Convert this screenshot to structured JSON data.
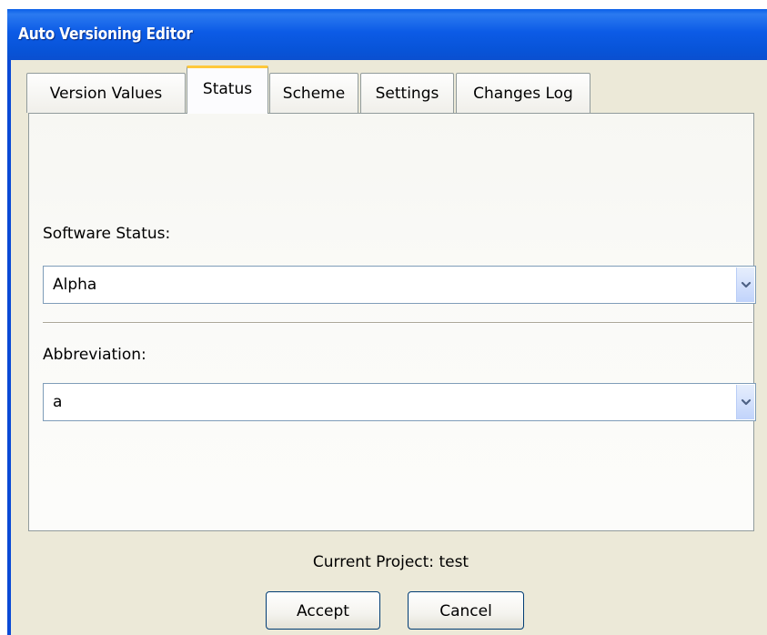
{
  "window": {
    "title": "Auto Versioning Editor"
  },
  "tabs": [
    {
      "label": "Version Values",
      "active": false
    },
    {
      "label": "Status",
      "active": true
    },
    {
      "label": "Scheme",
      "active": false
    },
    {
      "label": "Settings",
      "active": false
    },
    {
      "label": "Changes Log",
      "active": false
    }
  ],
  "status_tab": {
    "software_status_label": "Software Status:",
    "software_status_value": "Alpha",
    "abbreviation_label": "Abbreviation:",
    "abbreviation_value": "a"
  },
  "footer": {
    "current_project": "Current Project: test",
    "accept_label": "Accept",
    "cancel_label": "Cancel"
  },
  "icons": {
    "dropdown": "chevron-down-icon"
  },
  "colors": {
    "titlebar": "#0a5fe8",
    "active_tab_highlight": "#ffc83c",
    "window_bg": "#ece9d8"
  }
}
